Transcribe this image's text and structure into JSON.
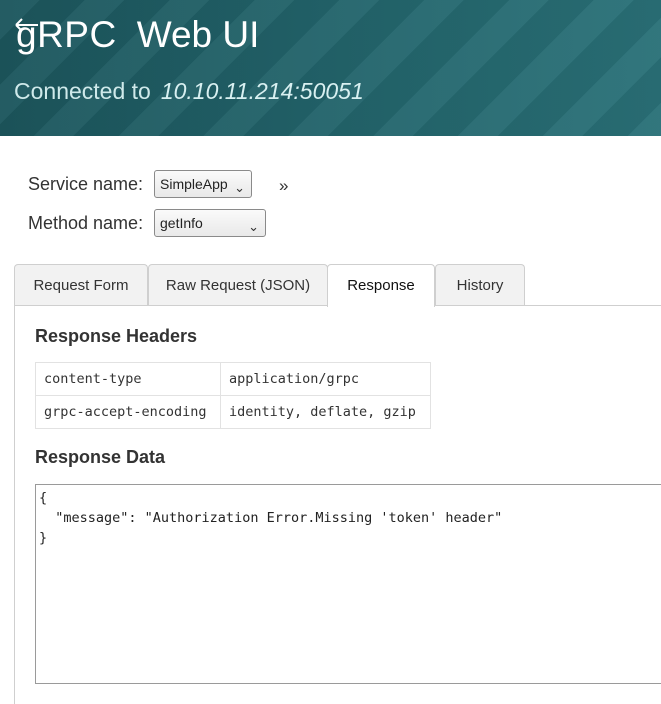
{
  "header": {
    "brand": "gRPC",
    "app_name": "Web UI",
    "connected_label": "Connected to",
    "address": "10.10.11.214:50051"
  },
  "selectors": {
    "service_label": "Service name:",
    "service_value": "SimpleApp",
    "method_label": "Method name:",
    "method_value": "getInfo",
    "expand_glyph": "»"
  },
  "tabs": [
    {
      "label": "Request Form",
      "active": false
    },
    {
      "label": "Raw Request (JSON)",
      "active": false
    },
    {
      "label": "Response",
      "active": true
    },
    {
      "label": "History",
      "active": false
    }
  ],
  "response": {
    "headers_title": "Response Headers",
    "headers": [
      {
        "key": "content-type",
        "value": "application/grpc"
      },
      {
        "key": "grpc-accept-encoding",
        "value": "identity, deflate, gzip"
      }
    ],
    "data_title": "Response Data",
    "data_lines": [
      "{",
      "  \"message\": \"Authorization Error.Missing 'token' header\"",
      "}"
    ]
  },
  "colors": {
    "header_bg": "#1e5c63",
    "header_text": "#ffffff",
    "address_text": "#d8f0f1"
  }
}
